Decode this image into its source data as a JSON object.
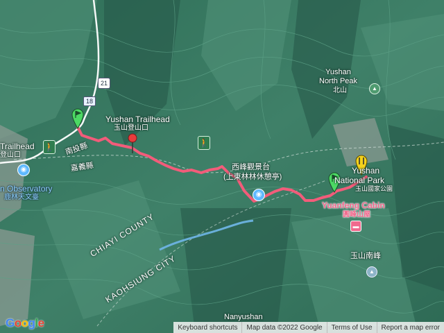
{
  "map": {
    "attribution": {
      "google_logo": "Google",
      "keyboard_shortcuts": "Keyboard shortcuts",
      "map_data": "Map data ©2022 Google",
      "terms": "Terms of Use",
      "report": "Report a map error"
    },
    "labels": {
      "yushan_trailhead_en": "Yushan Trailhead",
      "yushan_trailhead_zh": "玉山登山口",
      "left_trailhead_en": "Trailhead",
      "left_trailhead_zh": "登山口",
      "observatory_en": "n Observatory",
      "observatory_zh": "鹿林天文臺",
      "xifeng_zh_1": "西峰觀景台",
      "xifeng_zh_2": "(上東林林休憩亭)",
      "yushan_np_1": "Yushan",
      "yushan_np_2": "National Park",
      "yushan_np_zh": "玉山國家公園",
      "north_peak_en": "Yushan\nNorth Peak",
      "north_peak_zh": "北山",
      "yuanfeng_en": "Yuanfeng Cabin",
      "yuanfeng_zh": "圓峰山屋",
      "south_peak_zh": "玉山南峰",
      "chiayi_county": "CHIAYI COUNTY",
      "kaohsiung_city": "KAOHSIUNG CITY",
      "nantou_county_zh": "南投縣",
      "chiayi_county_zh": "嘉義縣",
      "nanyushan": "Nanyushan",
      "route_21": "21",
      "route_18": "18"
    },
    "icons": {
      "trailhead_left": "hiking-icon",
      "trailhead_mid": "hiking-icon",
      "observatory": "camera-icon",
      "viewpoint": "camera-icon",
      "north_peak": "mountain-icon",
      "south_peak": "mountain-icon",
      "cabin": "bed-icon"
    },
    "colors": {
      "route": "#f25c7a",
      "terrain": "#3d7a63",
      "start_flag": "#4cd964",
      "end_flag": "#f4d21c",
      "waypoint_pin": "#e83c3c",
      "poi_label": "#f06a8e",
      "poi_blue": "#5fb9ff"
    }
  }
}
